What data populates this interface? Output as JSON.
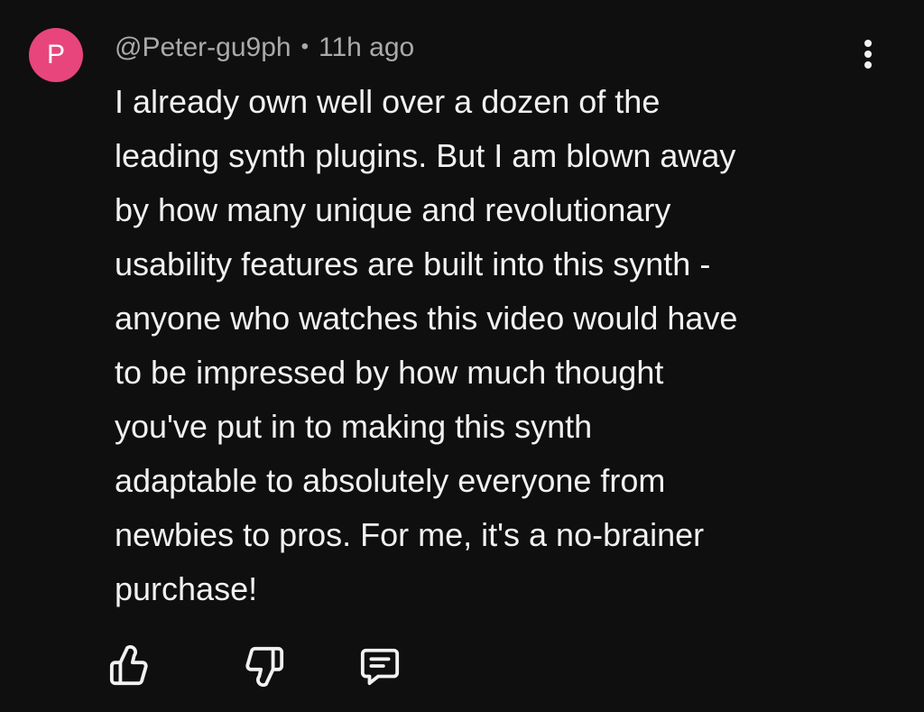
{
  "comment": {
    "avatar_letter": "P",
    "avatar_color": "#e8457c",
    "author": "@Peter-gu9ph",
    "separator": "•",
    "timestamp": "11h ago",
    "text": "I already own well over a dozen of the\nleading synth plugins. But I am blown away\nby how many unique and revolutionary\nusability features are built into this synth -\nanyone who watches this video would have\nto be impressed by how much thought\nyou've put in to making this synth\nadaptable to absolutely everyone from\nnewbies to pros. For me, it's a no-brainer\npurchase!"
  },
  "icons": {
    "more": "more-vertical-icon",
    "like": "thumbs-up-icon",
    "dislike": "thumbs-down-icon",
    "reply": "comment-icon"
  },
  "colors": {
    "background": "#0f0f0f",
    "text": "#f1f1f1",
    "secondary_text": "#aaaaaa"
  }
}
